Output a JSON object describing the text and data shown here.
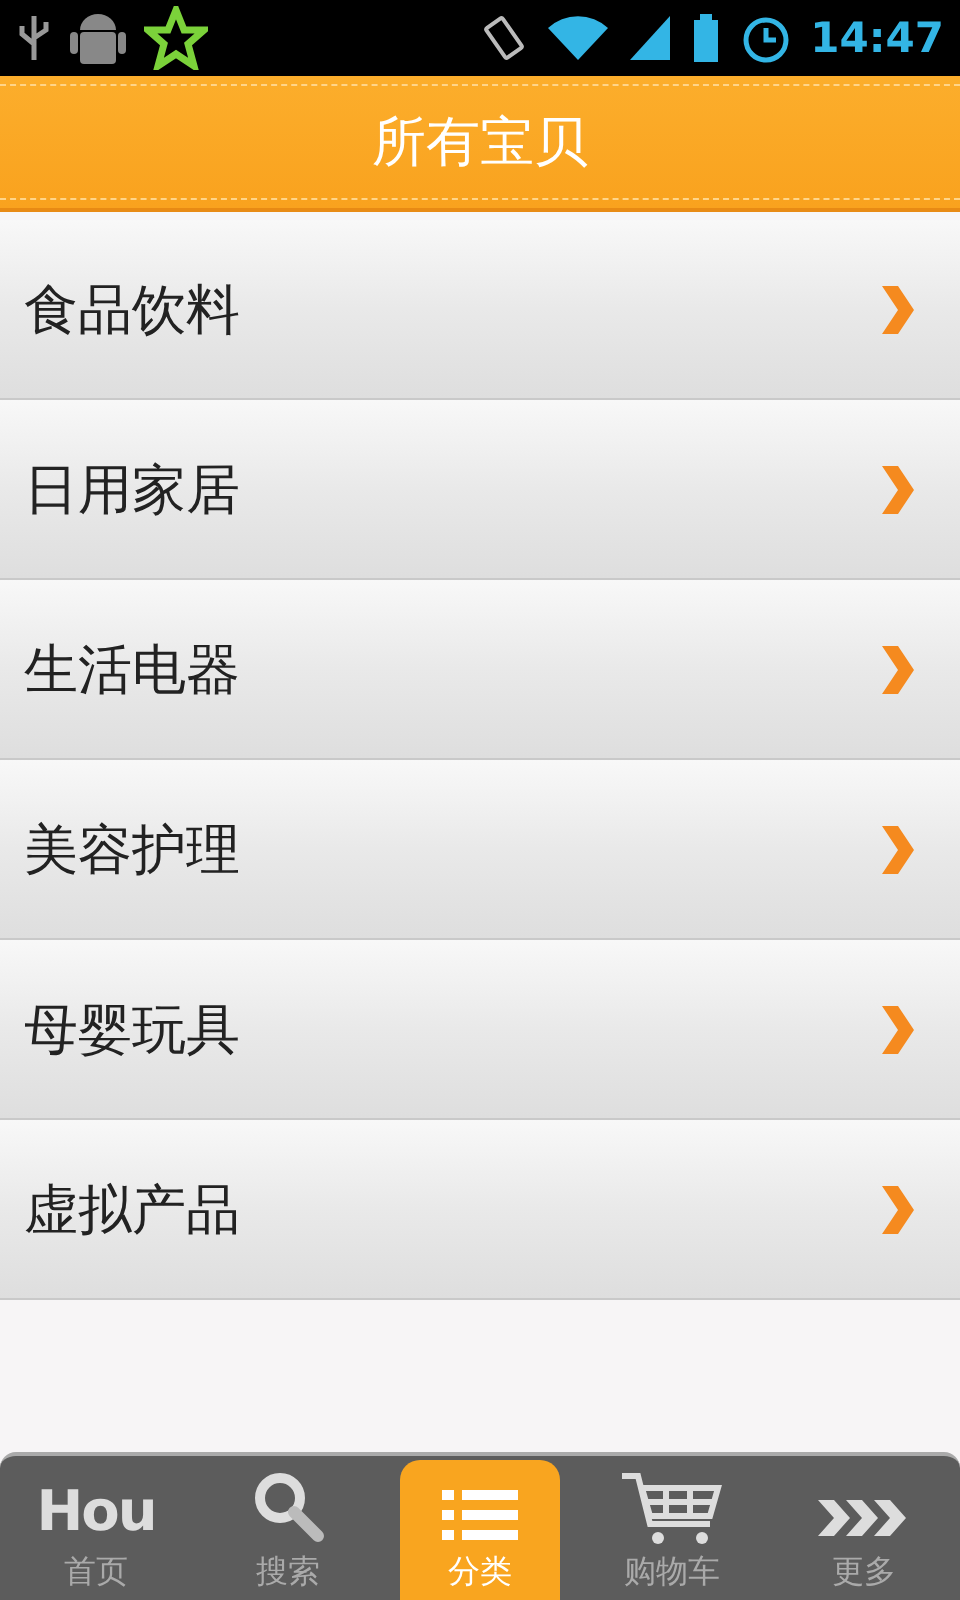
{
  "status_bar": {
    "time": "14:47"
  },
  "header": {
    "title": "所有宝贝"
  },
  "categories": [
    {
      "label": "食品饮料"
    },
    {
      "label": "日用家居"
    },
    {
      "label": "生活电器"
    },
    {
      "label": "美容护理"
    },
    {
      "label": "母婴玩具"
    },
    {
      "label": "虚拟产品"
    }
  ],
  "tab_bar": [
    {
      "kind": "logo",
      "logo_text": "Hou",
      "label": "首页",
      "selected": false
    },
    {
      "kind": "search",
      "label": "搜索",
      "selected": false
    },
    {
      "kind": "list",
      "label": "分类",
      "selected": true
    },
    {
      "kind": "cart",
      "label": "购物车",
      "selected": false
    },
    {
      "kind": "more",
      "label": "更多",
      "selected": false
    }
  ]
}
